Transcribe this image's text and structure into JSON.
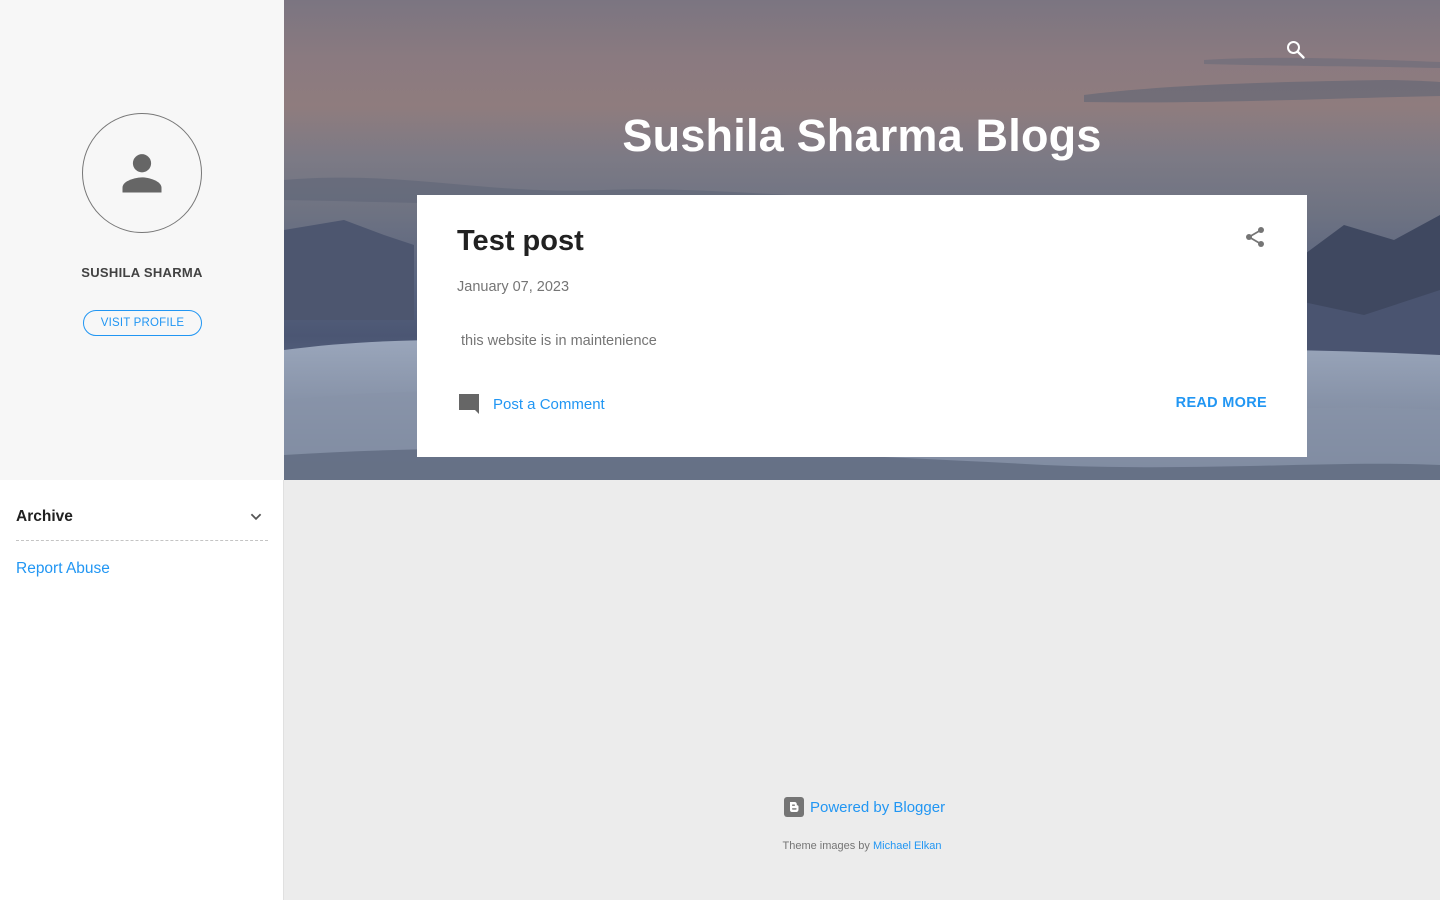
{
  "sidebar": {
    "profile_name": "SUSHILA SHARMA",
    "visit_profile_label": "VISIT PROFILE",
    "archive_label": "Archive",
    "report_abuse_label": "Report Abuse"
  },
  "header": {
    "blog_title": "Sushila Sharma Blogs"
  },
  "post": {
    "title": "Test post",
    "date": "January 07, 2023",
    "snippet": "this website is in maintenience",
    "comment_label": "Post a Comment",
    "read_more_label": "READ MORE"
  },
  "footer": {
    "powered_label": "Powered by Blogger",
    "theme_images_prefix": "Theme images by",
    "theme_images_author": "Michael Elkan"
  },
  "colors": {
    "link": "#2196f3",
    "text_dark": "#212121",
    "text_muted": "#757575",
    "sidebar_profile_bg": "#f7f7f7",
    "page_bg": "#ececec"
  },
  "icons": [
    "search-icon",
    "person-icon",
    "chevron-down-icon",
    "share-icon",
    "comment-icon",
    "blogger-logo-icon"
  ]
}
